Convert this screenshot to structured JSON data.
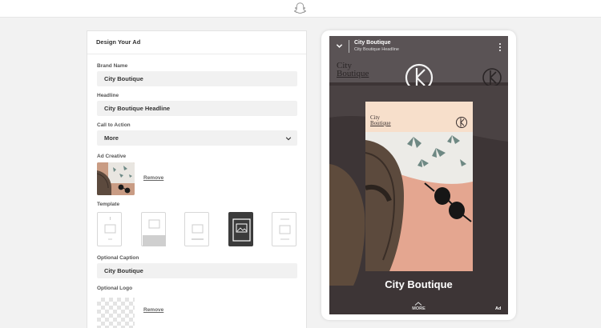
{
  "form": {
    "title": "Design Your Ad",
    "brand_name": {
      "label": "Brand Name",
      "value": "City Boutique"
    },
    "headline": {
      "label": "Headline",
      "value": "City Boutique Headline"
    },
    "call_to_action": {
      "label": "Call to Action",
      "value": "More"
    },
    "ad_creative": {
      "label": "Ad Creative",
      "remove_label": "Remove"
    },
    "template": {
      "label": "Template",
      "selected_index": 3,
      "count": 5
    },
    "optional_caption": {
      "label": "Optional Caption",
      "value": "City Boutique"
    },
    "optional_logo": {
      "label": "Optional Logo",
      "remove_label": "Remove"
    }
  },
  "preview": {
    "header_title": "City Boutique",
    "header_subtitle": "City Boutique Headline",
    "brand_line1": "City",
    "brand_line2": "Boutique",
    "card_brand_line1": "City",
    "card_brand_line2": "Boutique",
    "caption": "City Boutique",
    "cta": "MORE",
    "ad_tag": "Ad"
  },
  "colors": {
    "accent_dark": "#3b3b3b",
    "field_bg": "#f1f1f1",
    "preview_bg": "#3d3536",
    "card_bg": "#f8e2cf"
  }
}
